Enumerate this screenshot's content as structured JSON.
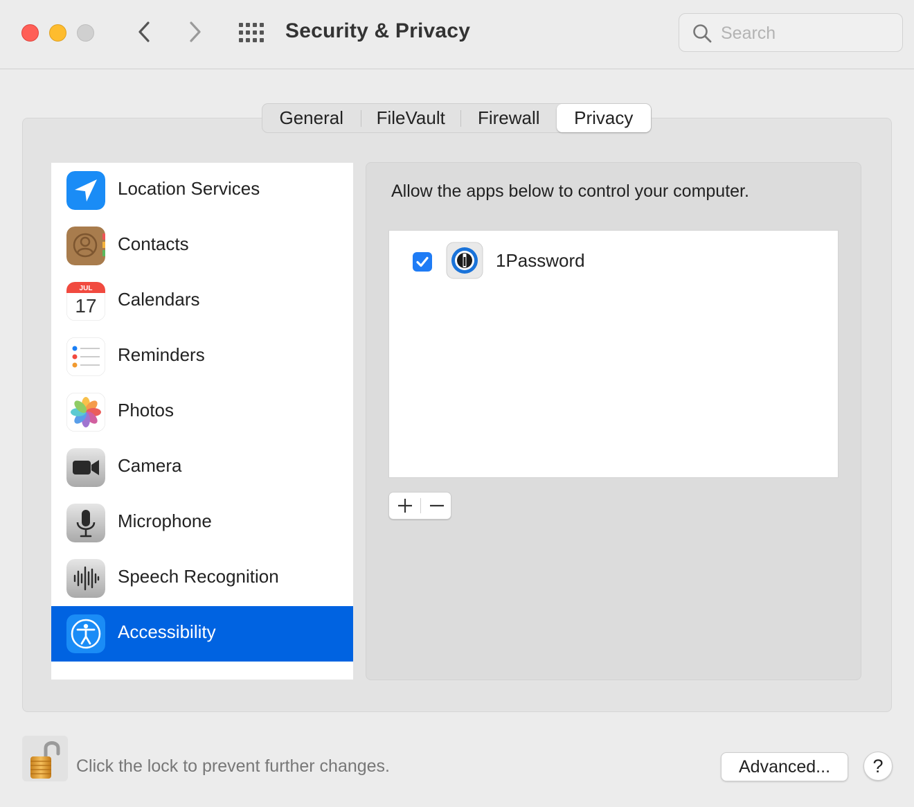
{
  "window": {
    "title": "Security & Privacy",
    "traffic_lights": [
      "close",
      "minimize",
      "zoom"
    ],
    "nav": {
      "back_icon": "chevron-left-icon",
      "forward_icon": "chevron-right-icon",
      "grid_icon": "grid-icon"
    }
  },
  "search": {
    "placeholder": "Search",
    "value": ""
  },
  "tabs": [
    {
      "label": "General",
      "selected": false
    },
    {
      "label": "FileVault",
      "selected": false
    },
    {
      "label": "Firewall",
      "selected": false
    },
    {
      "label": "Privacy",
      "selected": true
    }
  ],
  "sidebar": {
    "items": [
      {
        "label": "Location Services",
        "icon": "location-arrow-icon",
        "selected": false
      },
      {
        "label": "Contacts",
        "icon": "contacts-book-icon",
        "selected": false
      },
      {
        "label": "Calendars",
        "icon": "calendar-icon",
        "selected": false,
        "calendar_month": "JUL",
        "calendar_day": "17"
      },
      {
        "label": "Reminders",
        "icon": "reminders-list-icon",
        "selected": false
      },
      {
        "label": "Photos",
        "icon": "photos-flower-icon",
        "selected": false
      },
      {
        "label": "Camera",
        "icon": "video-camera-icon",
        "selected": false
      },
      {
        "label": "Microphone",
        "icon": "microphone-icon",
        "selected": false
      },
      {
        "label": "Speech Recognition",
        "icon": "waveform-icon",
        "selected": false
      },
      {
        "label": "Accessibility",
        "icon": "accessibility-icon",
        "selected": true
      }
    ]
  },
  "main": {
    "description": "Allow the apps below to control your computer.",
    "apps": [
      {
        "name": "1Password",
        "checked": true,
        "icon": "1password-icon"
      }
    ],
    "add_label": "+",
    "remove_label": "−"
  },
  "footer": {
    "lock_text": "Click the lock to prevent further changes.",
    "lock_icon": "unlocked-padlock-icon",
    "advanced_label": "Advanced...",
    "help_label": "?"
  },
  "colors": {
    "selection": "#0063e1",
    "checkbox": "#1f7cf5",
    "close": "#ff5f57",
    "minimize": "#febc2e"
  }
}
